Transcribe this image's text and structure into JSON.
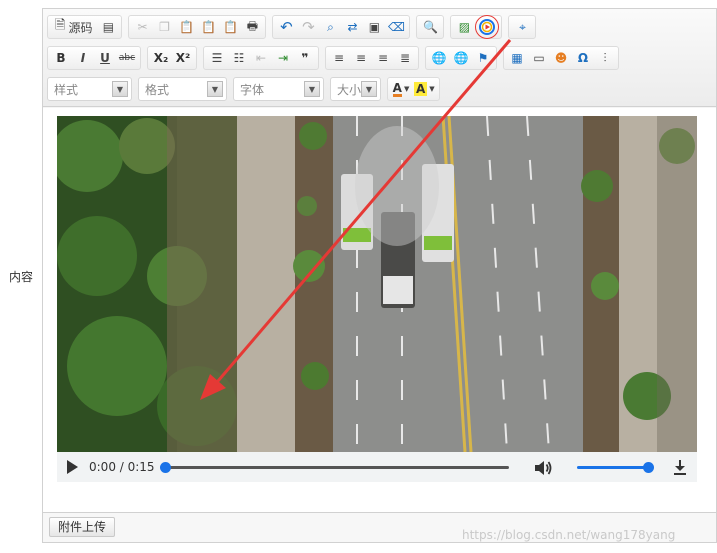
{
  "form": {
    "row_label": "内容"
  },
  "toolbar": {
    "source_label": "源码",
    "style_label": "样式",
    "format_label": "格式",
    "font_label": "字体",
    "size_label": "大小",
    "bold": "B",
    "italic": "I",
    "underline": "U",
    "strike": "abc",
    "subscript": "X₂",
    "superscript": "X²",
    "quote": "❞",
    "special_char": "Ω",
    "font_color_glyph": "A",
    "bg_color_glyph": "A"
  },
  "video": {
    "time_label": "0:00 / 0:15",
    "progress": 0,
    "volume": 1.0
  },
  "footer": {
    "attach_button": "附件上传"
  },
  "watermark": "https://blog.csdn.net/wang178yang",
  "colors": {
    "accent": "#1a73e8",
    "highlight_ring": "#e53935",
    "arrow": "#e53935"
  }
}
